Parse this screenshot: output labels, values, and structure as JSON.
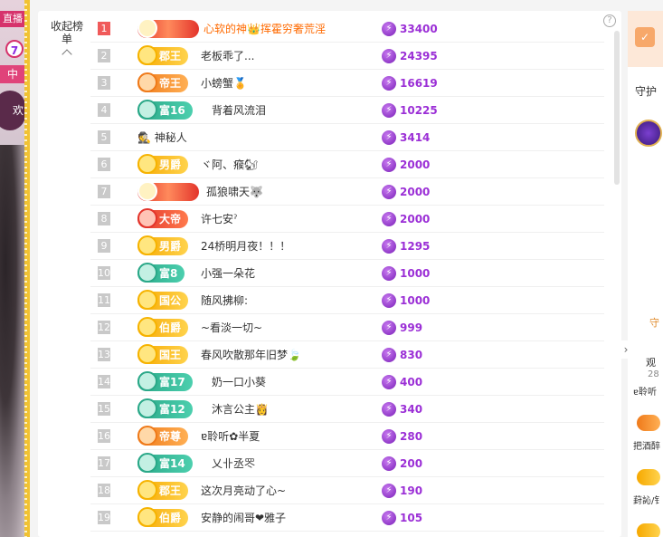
{
  "left_strip": {
    "live_label": "直播",
    "num_badge": "7",
    "pink_tag": "中",
    "circle_text": "欢"
  },
  "panel": {
    "collapse_label": "收起榜单",
    "help": "?",
    "rows": [
      {
        "rank": "1",
        "badge": "",
        "badge_style": "deco",
        "name": "心软的神👑挥霍穷奢荒淫",
        "score": "33400",
        "hot": true
      },
      {
        "rank": "2",
        "badge": "郡王",
        "badge_style": "gold",
        "name": "老板乖了...",
        "score": "24395"
      },
      {
        "rank": "3",
        "badge": "帝王",
        "badge_style": "orange",
        "name": "小螃蟹🏅",
        "score": "16619"
      },
      {
        "rank": "4",
        "badge": "富16",
        "badge_style": "teal",
        "name": "背着风流泪",
        "score": "10225"
      },
      {
        "rank": "5",
        "badge": "",
        "badge_style": "none",
        "name": "🕵 神秘人",
        "score": "3414"
      },
      {
        "rank": "6",
        "badge": "男爵",
        "badge_style": "gold",
        "name": "ヾ阿、瘊🐿",
        "score": "2000"
      },
      {
        "rank": "7",
        "badge": "",
        "badge_style": "deco",
        "name": "孤狼啸天🐺",
        "score": "2000"
      },
      {
        "rank": "8",
        "badge": "大帝",
        "badge_style": "red",
        "name": "许七安ˀ",
        "score": "2000"
      },
      {
        "rank": "9",
        "badge": "男爵",
        "badge_style": "gold",
        "name": "24桥明月夜！！！",
        "score": "1295"
      },
      {
        "rank": "10",
        "badge": "富8",
        "badge_style": "teal",
        "name": "小强一朵花",
        "score": "1000"
      },
      {
        "rank": "11",
        "badge": "国公",
        "badge_style": "gold",
        "name": "随风拂柳:",
        "score": "1000"
      },
      {
        "rank": "12",
        "badge": "伯爵",
        "badge_style": "gold",
        "name": "~看淡一切~",
        "score": "999"
      },
      {
        "rank": "13",
        "badge": "国王",
        "badge_style": "gold",
        "name": "春风吹散那年旧梦🍃",
        "score": "830"
      },
      {
        "rank": "14",
        "badge": "富17",
        "badge_style": "teal",
        "name": "奶一口小葵",
        "score": "400"
      },
      {
        "rank": "15",
        "badge": "富12",
        "badge_style": "teal",
        "name": "沐言公主👸",
        "score": "340"
      },
      {
        "rank": "16",
        "badge": "帝尊",
        "badge_style": "orange",
        "name": "ɐ聆听✿半夏",
        "score": "280"
      },
      {
        "rank": "17",
        "badge": "富14",
        "badge_style": "teal",
        "name": "乂卝丞罖",
        "score": "200"
      },
      {
        "rank": "18",
        "badge": "郡王",
        "badge_style": "gold",
        "name": "这次月亮动了心~",
        "score": "190"
      },
      {
        "rank": "19",
        "badge": "伯爵",
        "badge_style": "gold",
        "name": "安静的闹哥❤雅子",
        "score": "105"
      }
    ]
  },
  "right_panel": {
    "guard_label": "守护",
    "guard_label2": "守",
    "viewers_label": "观",
    "viewers_count": "28",
    "item1": "ɐ聆听",
    "item2": "把酒醉",
    "item3": "葑訫/钅"
  },
  "icons": {
    "rank_badge": "medal-icon",
    "score": "lightning-icon",
    "help": "question-icon",
    "collapse": "chevron-up-icon"
  }
}
